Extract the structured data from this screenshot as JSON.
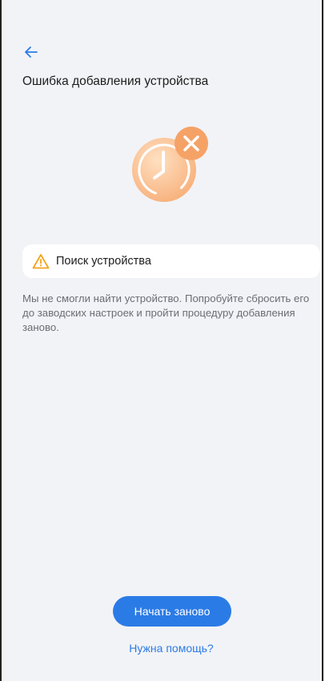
{
  "header": {
    "back_icon": "arrow-left-icon",
    "title": "Ошибка добавления устройства"
  },
  "illustration": {
    "icon": "clock-error-icon",
    "accent_color": "#f3a46e"
  },
  "status": {
    "icon": "warning-icon",
    "label": "Поиск устройства",
    "color": "#f2a31c"
  },
  "description": "Мы не смогли найти устройство. Попробуйте сбросить его до заводских настроек и пройти процедуру добавления заново.",
  "actions": {
    "restart_label": "Начать заново",
    "help_label": "Нужна помощь?",
    "primary_color": "#2b7be6"
  }
}
